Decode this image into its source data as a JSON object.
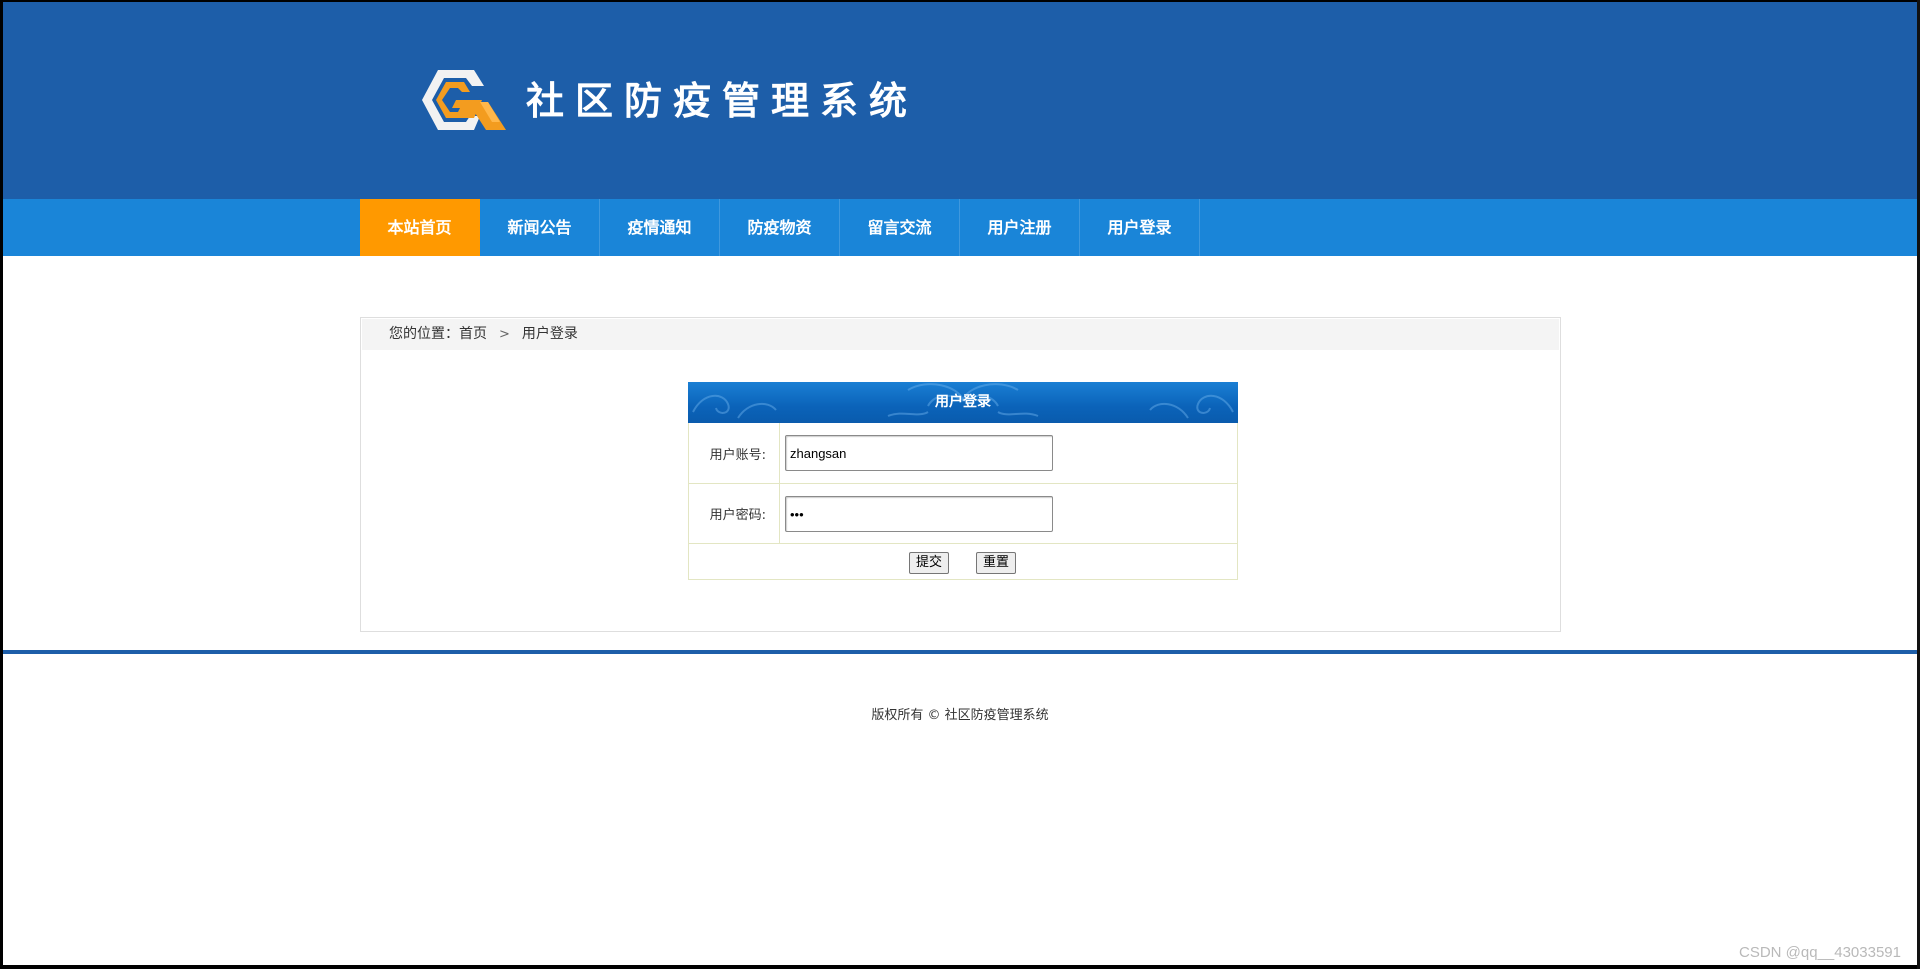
{
  "header": {
    "site_title": "社区防疫管理系统",
    "logo_icon": "hexagon-g-logo-icon"
  },
  "nav": {
    "items": [
      {
        "label": "本站首页",
        "active": true
      },
      {
        "label": "新闻公告",
        "active": false
      },
      {
        "label": "疫情通知",
        "active": false
      },
      {
        "label": "防疫物资",
        "active": false
      },
      {
        "label": "留言交流",
        "active": false
      },
      {
        "label": "用户注册",
        "active": false
      },
      {
        "label": "用户登录",
        "active": false
      }
    ]
  },
  "breadcrumb": {
    "prefix": "您的位置：",
    "home": "首页",
    "separator": ">",
    "current": "用户登录"
  },
  "login": {
    "title": "用户登录",
    "username_label": "用户账号:",
    "username_value": "zhangsan",
    "password_label": "用户密码:",
    "password_value": "123",
    "submit_label": "提交",
    "reset_label": "重置"
  },
  "footer": {
    "copyright": "版权所有 © 社区防疫管理系统"
  },
  "watermark": "CSDN @qq__43033591",
  "colors": {
    "header_bg": "#1d5ea9",
    "nav_bg": "#1a85d8",
    "nav_active": "#ff9900",
    "login_head": "#0b63b9"
  }
}
